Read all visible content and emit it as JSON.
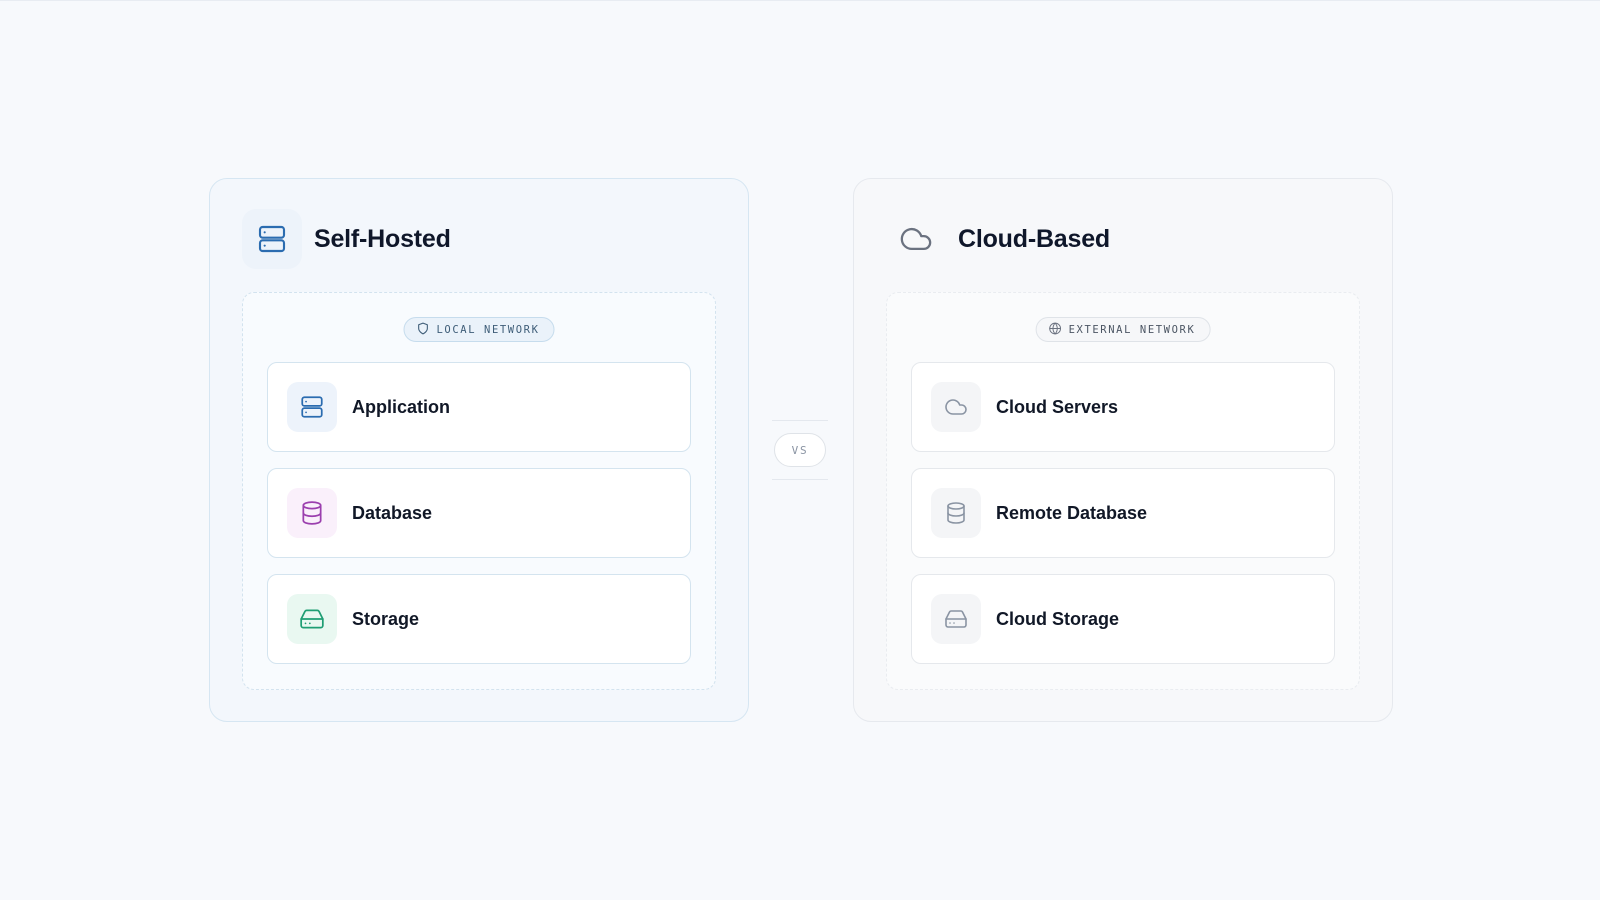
{
  "colors": {
    "background": "#f7f9fc",
    "self_hosted_accent": "#2b6cb0",
    "database_accent": "#9b3fae",
    "storage_accent": "#1f9e74",
    "cloud_accent": "#8a94a3"
  },
  "self_hosted": {
    "title": "Self-Hosted",
    "icon": "server-icon",
    "network_badge": {
      "label": "LOCAL NETWORK",
      "icon": "shield-icon"
    },
    "items": [
      {
        "label": "Application",
        "icon": "server-icon",
        "accent": "#2b6cb0",
        "icon_bg": "#edf3fb"
      },
      {
        "label": "Database",
        "icon": "database-icon",
        "accent": "#9b3fae",
        "icon_bg": "#faf0fb"
      },
      {
        "label": "Storage",
        "icon": "hard-drive-icon",
        "accent": "#1f9e74",
        "icon_bg": "#e9f8f1"
      }
    ]
  },
  "divider": {
    "label": "VS"
  },
  "cloud_based": {
    "title": "Cloud-Based",
    "icon": "cloud-icon",
    "network_badge": {
      "label": "EXTERNAL NETWORK",
      "icon": "globe-icon"
    },
    "items": [
      {
        "label": "Cloud Servers",
        "icon": "cloud-icon",
        "accent": "#8a94a3",
        "icon_bg": "#f4f5f7"
      },
      {
        "label": "Remote Database",
        "icon": "database-icon",
        "accent": "#8a94a3",
        "icon_bg": "#f4f5f7"
      },
      {
        "label": "Cloud Storage",
        "icon": "hard-drive-icon",
        "accent": "#8a94a3",
        "icon_bg": "#f4f5f7"
      }
    ]
  }
}
